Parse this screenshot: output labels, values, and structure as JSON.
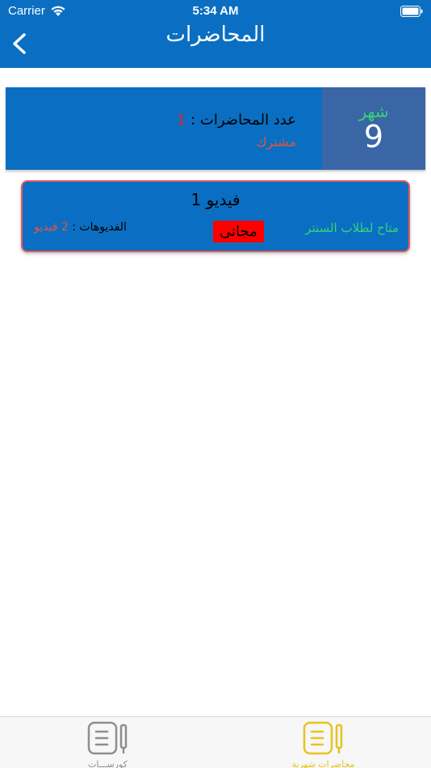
{
  "status_bar": {
    "carrier": "Carrier",
    "time": "5:34 AM"
  },
  "nav": {
    "title": "المحاضرات"
  },
  "month_card": {
    "month_label": "شهر",
    "month_number": "9",
    "lectures_label": "عدد المحاضرات :",
    "lectures_count": "1",
    "status": "مشترك"
  },
  "video": {
    "title": "فيديو 1",
    "availability": "متاح لطلاب السنتر",
    "price_badge": "مجانى",
    "videos_label": "الفديوهات :",
    "videos_count": "2 فيديو"
  },
  "tabs": [
    {
      "label": "كورســـات",
      "icon": "notebook-pencil-icon",
      "active": false
    },
    {
      "label": "محاضرات شهرية",
      "icon": "notebook-pencil-icon",
      "active": true
    }
  ],
  "colors": {
    "primary": "#0a6fc2",
    "month_box": "#3a66a5",
    "green": "#38d17a",
    "red": "#e02626",
    "badge": "#ff0000",
    "active_tab": "#e8c222",
    "inactive_tab": "#8e8e8e"
  }
}
